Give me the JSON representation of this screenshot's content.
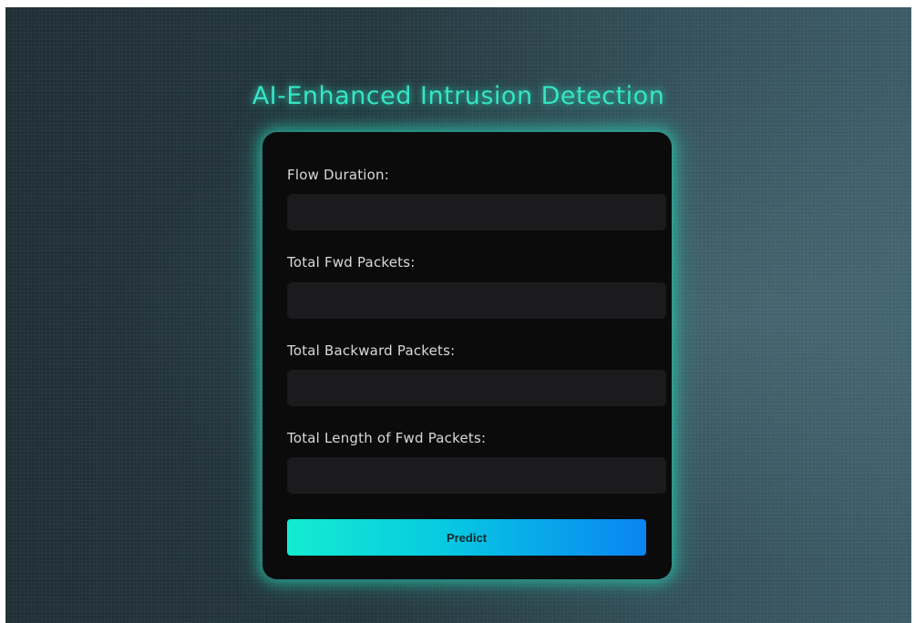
{
  "page": {
    "title": "AI-Enhanced Intrusion Detection"
  },
  "form": {
    "fields": [
      {
        "label": "Flow Duration:",
        "value": "",
        "placeholder": ""
      },
      {
        "label": "Total Fwd Packets:",
        "value": "",
        "placeholder": ""
      },
      {
        "label": "Total Backward Packets:",
        "value": "",
        "placeholder": ""
      },
      {
        "label": "Total Length of Fwd Packets:",
        "value": "",
        "placeholder": ""
      }
    ],
    "submit_label": "Predict"
  },
  "colors": {
    "accent": "#35e6c6",
    "card_background": "#0b0b0c",
    "input_background": "#1b1b1d",
    "button_gradient_start": "#14ecd0",
    "button_gradient_end": "#0a84f2"
  }
}
